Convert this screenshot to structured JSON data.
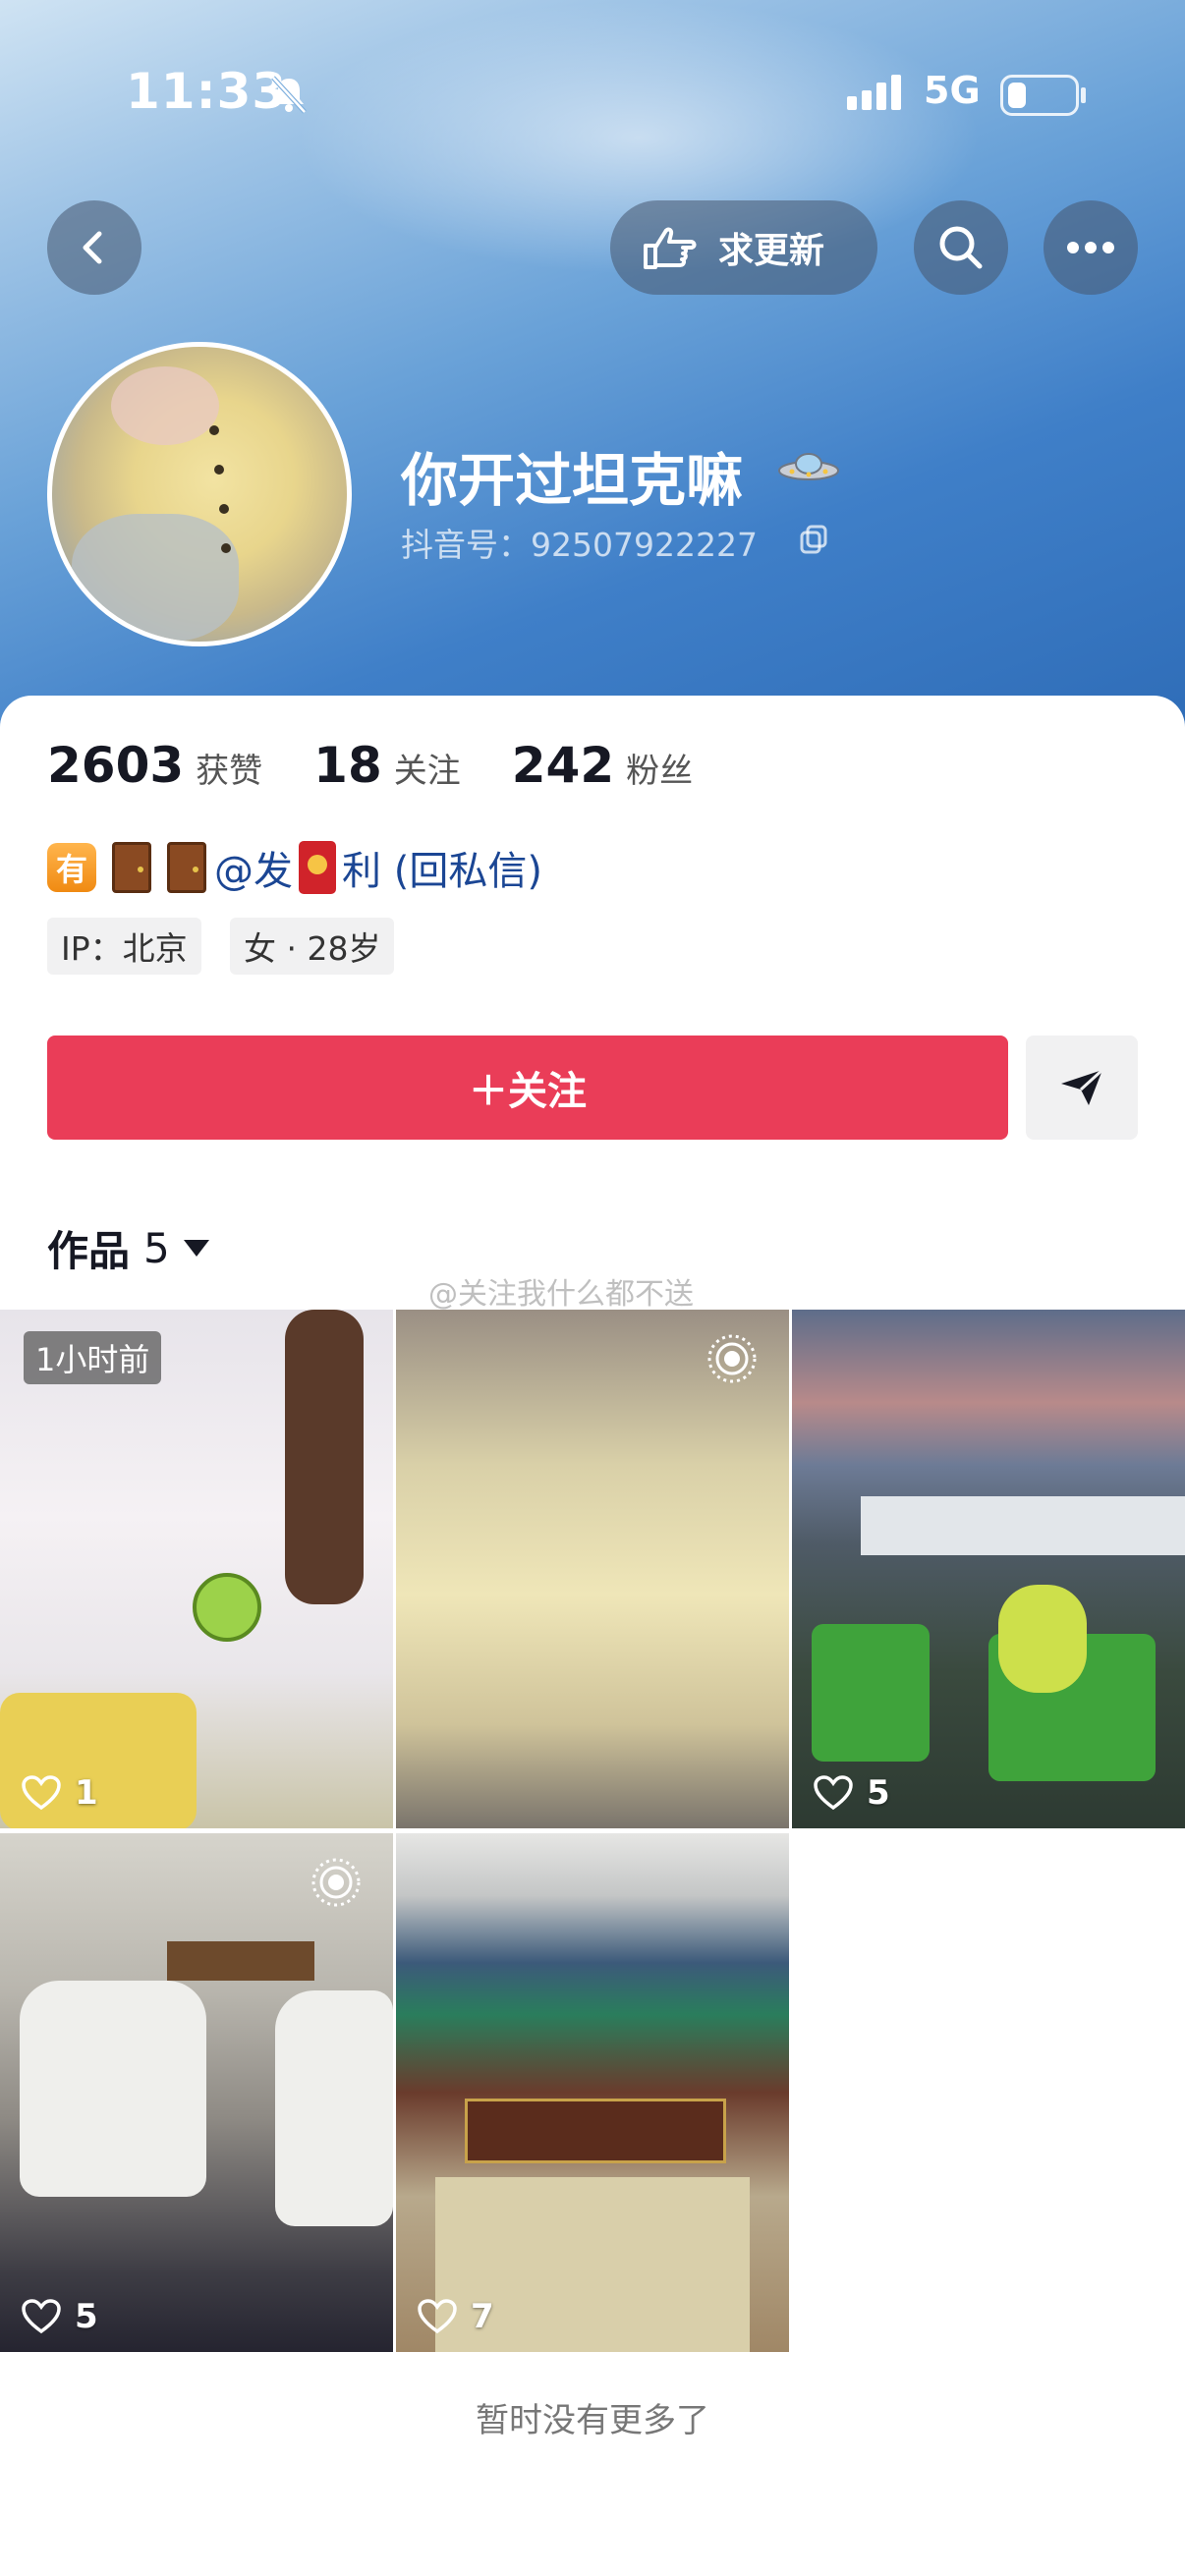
{
  "status": {
    "time": "11:33",
    "network": "5G"
  },
  "header": {
    "request_update_label": "求更新"
  },
  "profile": {
    "name": "你开过坦克嘛",
    "account": "抖音号：92507922227"
  },
  "stats": [
    {
      "value": "2603",
      "label": "获赞"
    },
    {
      "value": "18",
      "label": "关注"
    },
    {
      "value": "242",
      "label": "粉丝"
    }
  ],
  "bio": {
    "you_emoji": "有",
    "text1": "@发",
    "text2": "利 (回私信)"
  },
  "tags": {
    "ip": "IP：北京",
    "info": "女 · 28岁"
  },
  "actions": {
    "follow_label": "＋关注"
  },
  "works": {
    "label": "作品",
    "count": "5"
  },
  "watermark": "@关注我什么都不送",
  "videos": [
    {
      "likes": "1",
      "badge": "1小时前"
    },
    {
      "likes": ""
    },
    {
      "likes": "5"
    },
    {
      "likes": "5"
    },
    {
      "likes": "7"
    }
  ],
  "footer": {
    "no_more": "暂时没有更多了"
  },
  "colors": {
    "follow": "#ea3d58",
    "bio_link": "#1b4694"
  }
}
